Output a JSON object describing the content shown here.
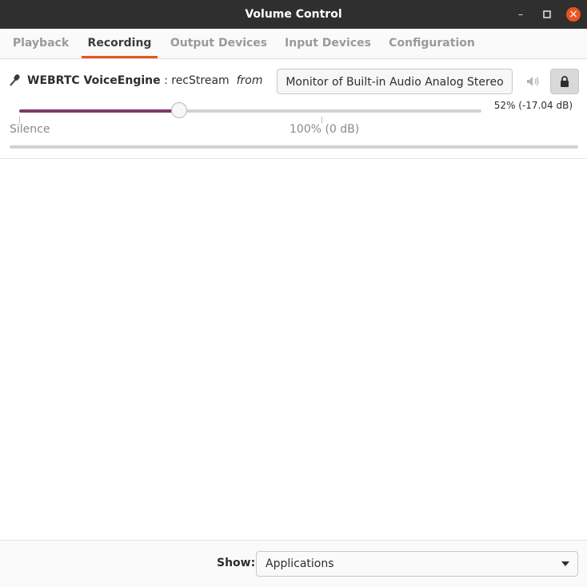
{
  "window": {
    "title": "Volume Control",
    "controls": [
      "minimize-icon",
      "maximize-icon",
      "close-icon"
    ],
    "accent": "#e95420"
  },
  "tabs": [
    {
      "label": "Playback",
      "active": false
    },
    {
      "label": "Recording",
      "active": true
    },
    {
      "label": "Output Devices",
      "active": false
    },
    {
      "label": "Input Devices",
      "active": false
    },
    {
      "label": "Configuration",
      "active": false
    }
  ],
  "stream": {
    "icon": "microphone-icon",
    "app_name": "WEBRTC VoiceEngine",
    "separator": " : ",
    "stream_name": "recStream",
    "from_label": "from",
    "device": "Monitor of Built-in Audio Analog Stereo",
    "mute_icon": "speaker-muted-icon",
    "lock_icon": "lock-icon",
    "volume_fraction": 0.52,
    "volume_text": "52% (-17.04 dB)",
    "scale_start_label": "Silence",
    "scale_mid_label": "100% (0 dB)",
    "slider_color": "#7b3b6c"
  },
  "footer": {
    "show_label": "Show:",
    "show_value": "Applications"
  }
}
